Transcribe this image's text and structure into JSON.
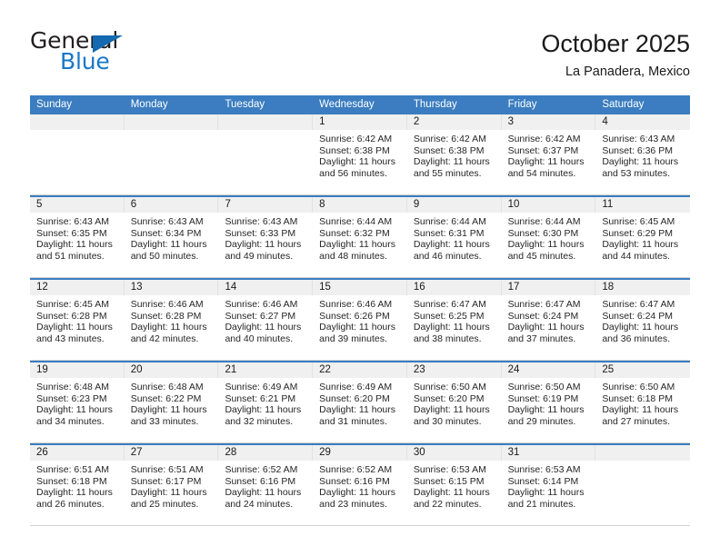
{
  "brand": {
    "name_top": "General",
    "name_bottom": "Blue",
    "accent_color": "#1877c9",
    "triangle_color": "#1469b0"
  },
  "header": {
    "title": "October 2025",
    "subtitle": "La Panadera, Mexico"
  },
  "theme": {
    "header_row_bg": "#3b7dc0",
    "day_band_bg": "#f0f0f0",
    "row_divider": "#3b7dc0"
  },
  "weekdays": [
    "Sunday",
    "Monday",
    "Tuesday",
    "Wednesday",
    "Thursday",
    "Friday",
    "Saturday"
  ],
  "weeks": [
    [
      {
        "day": "",
        "empty": true,
        "sunrise": "",
        "sunset": "",
        "daylight_1": "",
        "daylight_2": ""
      },
      {
        "day": "",
        "empty": true,
        "sunrise": "",
        "sunset": "",
        "daylight_1": "",
        "daylight_2": ""
      },
      {
        "day": "",
        "empty": true,
        "sunrise": "",
        "sunset": "",
        "daylight_1": "",
        "daylight_2": ""
      },
      {
        "day": "1",
        "sunrise": "Sunrise: 6:42 AM",
        "sunset": "Sunset: 6:38 PM",
        "daylight_1": "Daylight: 11 hours",
        "daylight_2": "and 56 minutes."
      },
      {
        "day": "2",
        "sunrise": "Sunrise: 6:42 AM",
        "sunset": "Sunset: 6:38 PM",
        "daylight_1": "Daylight: 11 hours",
        "daylight_2": "and 55 minutes."
      },
      {
        "day": "3",
        "sunrise": "Sunrise: 6:42 AM",
        "sunset": "Sunset: 6:37 PM",
        "daylight_1": "Daylight: 11 hours",
        "daylight_2": "and 54 minutes."
      },
      {
        "day": "4",
        "sunrise": "Sunrise: 6:43 AM",
        "sunset": "Sunset: 6:36 PM",
        "daylight_1": "Daylight: 11 hours",
        "daylight_2": "and 53 minutes."
      }
    ],
    [
      {
        "day": "5",
        "sunrise": "Sunrise: 6:43 AM",
        "sunset": "Sunset: 6:35 PM",
        "daylight_1": "Daylight: 11 hours",
        "daylight_2": "and 51 minutes."
      },
      {
        "day": "6",
        "sunrise": "Sunrise: 6:43 AM",
        "sunset": "Sunset: 6:34 PM",
        "daylight_1": "Daylight: 11 hours",
        "daylight_2": "and 50 minutes."
      },
      {
        "day": "7",
        "sunrise": "Sunrise: 6:43 AM",
        "sunset": "Sunset: 6:33 PM",
        "daylight_1": "Daylight: 11 hours",
        "daylight_2": "and 49 minutes."
      },
      {
        "day": "8",
        "sunrise": "Sunrise: 6:44 AM",
        "sunset": "Sunset: 6:32 PM",
        "daylight_1": "Daylight: 11 hours",
        "daylight_2": "and 48 minutes."
      },
      {
        "day": "9",
        "sunrise": "Sunrise: 6:44 AM",
        "sunset": "Sunset: 6:31 PM",
        "daylight_1": "Daylight: 11 hours",
        "daylight_2": "and 46 minutes."
      },
      {
        "day": "10",
        "sunrise": "Sunrise: 6:44 AM",
        "sunset": "Sunset: 6:30 PM",
        "daylight_1": "Daylight: 11 hours",
        "daylight_2": "and 45 minutes."
      },
      {
        "day": "11",
        "sunrise": "Sunrise: 6:45 AM",
        "sunset": "Sunset: 6:29 PM",
        "daylight_1": "Daylight: 11 hours",
        "daylight_2": "and 44 minutes."
      }
    ],
    [
      {
        "day": "12",
        "sunrise": "Sunrise: 6:45 AM",
        "sunset": "Sunset: 6:28 PM",
        "daylight_1": "Daylight: 11 hours",
        "daylight_2": "and 43 minutes."
      },
      {
        "day": "13",
        "sunrise": "Sunrise: 6:46 AM",
        "sunset": "Sunset: 6:28 PM",
        "daylight_1": "Daylight: 11 hours",
        "daylight_2": "and 42 minutes."
      },
      {
        "day": "14",
        "sunrise": "Sunrise: 6:46 AM",
        "sunset": "Sunset: 6:27 PM",
        "daylight_1": "Daylight: 11 hours",
        "daylight_2": "and 40 minutes."
      },
      {
        "day": "15",
        "sunrise": "Sunrise: 6:46 AM",
        "sunset": "Sunset: 6:26 PM",
        "daylight_1": "Daylight: 11 hours",
        "daylight_2": "and 39 minutes."
      },
      {
        "day": "16",
        "sunrise": "Sunrise: 6:47 AM",
        "sunset": "Sunset: 6:25 PM",
        "daylight_1": "Daylight: 11 hours",
        "daylight_2": "and 38 minutes."
      },
      {
        "day": "17",
        "sunrise": "Sunrise: 6:47 AM",
        "sunset": "Sunset: 6:24 PM",
        "daylight_1": "Daylight: 11 hours",
        "daylight_2": "and 37 minutes."
      },
      {
        "day": "18",
        "sunrise": "Sunrise: 6:47 AM",
        "sunset": "Sunset: 6:24 PM",
        "daylight_1": "Daylight: 11 hours",
        "daylight_2": "and 36 minutes."
      }
    ],
    [
      {
        "day": "19",
        "sunrise": "Sunrise: 6:48 AM",
        "sunset": "Sunset: 6:23 PM",
        "daylight_1": "Daylight: 11 hours",
        "daylight_2": "and 34 minutes."
      },
      {
        "day": "20",
        "sunrise": "Sunrise: 6:48 AM",
        "sunset": "Sunset: 6:22 PM",
        "daylight_1": "Daylight: 11 hours",
        "daylight_2": "and 33 minutes."
      },
      {
        "day": "21",
        "sunrise": "Sunrise: 6:49 AM",
        "sunset": "Sunset: 6:21 PM",
        "daylight_1": "Daylight: 11 hours",
        "daylight_2": "and 32 minutes."
      },
      {
        "day": "22",
        "sunrise": "Sunrise: 6:49 AM",
        "sunset": "Sunset: 6:20 PM",
        "daylight_1": "Daylight: 11 hours",
        "daylight_2": "and 31 minutes."
      },
      {
        "day": "23",
        "sunrise": "Sunrise: 6:50 AM",
        "sunset": "Sunset: 6:20 PM",
        "daylight_1": "Daylight: 11 hours",
        "daylight_2": "and 30 minutes."
      },
      {
        "day": "24",
        "sunrise": "Sunrise: 6:50 AM",
        "sunset": "Sunset: 6:19 PM",
        "daylight_1": "Daylight: 11 hours",
        "daylight_2": "and 29 minutes."
      },
      {
        "day": "25",
        "sunrise": "Sunrise: 6:50 AM",
        "sunset": "Sunset: 6:18 PM",
        "daylight_1": "Daylight: 11 hours",
        "daylight_2": "and 27 minutes."
      }
    ],
    [
      {
        "day": "26",
        "sunrise": "Sunrise: 6:51 AM",
        "sunset": "Sunset: 6:18 PM",
        "daylight_1": "Daylight: 11 hours",
        "daylight_2": "and 26 minutes."
      },
      {
        "day": "27",
        "sunrise": "Sunrise: 6:51 AM",
        "sunset": "Sunset: 6:17 PM",
        "daylight_1": "Daylight: 11 hours",
        "daylight_2": "and 25 minutes."
      },
      {
        "day": "28",
        "sunrise": "Sunrise: 6:52 AM",
        "sunset": "Sunset: 6:16 PM",
        "daylight_1": "Daylight: 11 hours",
        "daylight_2": "and 24 minutes."
      },
      {
        "day": "29",
        "sunrise": "Sunrise: 6:52 AM",
        "sunset": "Sunset: 6:16 PM",
        "daylight_1": "Daylight: 11 hours",
        "daylight_2": "and 23 minutes."
      },
      {
        "day": "30",
        "sunrise": "Sunrise: 6:53 AM",
        "sunset": "Sunset: 6:15 PM",
        "daylight_1": "Daylight: 11 hours",
        "daylight_2": "and 22 minutes."
      },
      {
        "day": "31",
        "sunrise": "Sunrise: 6:53 AM",
        "sunset": "Sunset: 6:14 PM",
        "daylight_1": "Daylight: 11 hours",
        "daylight_2": "and 21 minutes."
      },
      {
        "day": "",
        "empty": true,
        "sunrise": "",
        "sunset": "",
        "daylight_1": "",
        "daylight_2": ""
      }
    ]
  ]
}
